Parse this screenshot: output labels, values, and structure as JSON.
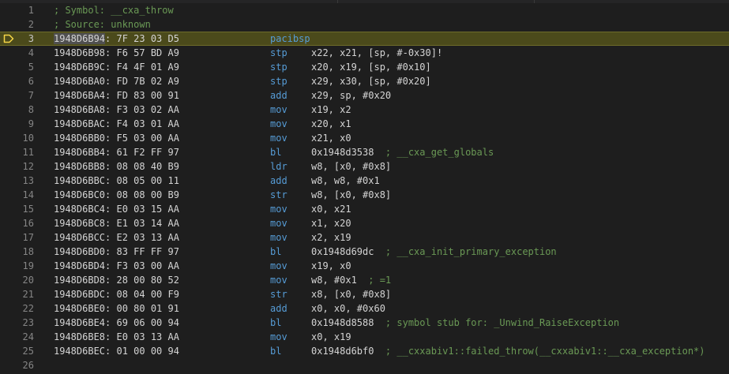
{
  "editor": {
    "lines": [
      {
        "n": "1",
        "comment": "; Symbol: __cxa_throw"
      },
      {
        "n": "2",
        "comment": "; Source: unknown"
      },
      {
        "n": "3",
        "addr": "1948D6B94",
        "bytes": ": 7F 23 03 D5",
        "mnem": "pacibsp",
        "ops": "",
        "cmt": "",
        "current": true
      },
      {
        "n": "4",
        "addr": "1948D6B98",
        "bytes": ": F6 57 BD A9",
        "mnem": "stp",
        "ops": "x22, x21, [sp, #-0x30]!",
        "cmt": ""
      },
      {
        "n": "5",
        "addr": "1948D6B9C",
        "bytes": ": F4 4F 01 A9",
        "mnem": "stp",
        "ops": "x20, x19, [sp, #0x10]",
        "cmt": ""
      },
      {
        "n": "6",
        "addr": "1948D6BA0",
        "bytes": ": FD 7B 02 A9",
        "mnem": "stp",
        "ops": "x29, x30, [sp, #0x20]",
        "cmt": ""
      },
      {
        "n": "7",
        "addr": "1948D6BA4",
        "bytes": ": FD 83 00 91",
        "mnem": "add",
        "ops": "x29, sp, #0x20",
        "cmt": ""
      },
      {
        "n": "8",
        "addr": "1948D6BA8",
        "bytes": ": F3 03 02 AA",
        "mnem": "mov",
        "ops": "x19, x2",
        "cmt": ""
      },
      {
        "n": "9",
        "addr": "1948D6BAC",
        "bytes": ": F4 03 01 AA",
        "mnem": "mov",
        "ops": "x20, x1",
        "cmt": ""
      },
      {
        "n": "10",
        "addr": "1948D6BB0",
        "bytes": ": F5 03 00 AA",
        "mnem": "mov",
        "ops": "x21, x0",
        "cmt": ""
      },
      {
        "n": "11",
        "addr": "1948D6BB4",
        "bytes": ": 61 F2 FF 97",
        "mnem": "bl",
        "ops": "0x1948d3538  ",
        "cmt": "; __cxa_get_globals"
      },
      {
        "n": "12",
        "addr": "1948D6BB8",
        "bytes": ": 08 08 40 B9",
        "mnem": "ldr",
        "ops": "w8, [x0, #0x8]",
        "cmt": ""
      },
      {
        "n": "13",
        "addr": "1948D6BBC",
        "bytes": ": 08 05 00 11",
        "mnem": "add",
        "ops": "w8, w8, #0x1",
        "cmt": ""
      },
      {
        "n": "14",
        "addr": "1948D6BC0",
        "bytes": ": 08 08 00 B9",
        "mnem": "str",
        "ops": "w8, [x0, #0x8]",
        "cmt": ""
      },
      {
        "n": "15",
        "addr": "1948D6BC4",
        "bytes": ": E0 03 15 AA",
        "mnem": "mov",
        "ops": "x0, x21",
        "cmt": ""
      },
      {
        "n": "16",
        "addr": "1948D6BC8",
        "bytes": ": E1 03 14 AA",
        "mnem": "mov",
        "ops": "x1, x20",
        "cmt": ""
      },
      {
        "n": "17",
        "addr": "1948D6BCC",
        "bytes": ": E2 03 13 AA",
        "mnem": "mov",
        "ops": "x2, x19",
        "cmt": ""
      },
      {
        "n": "18",
        "addr": "1948D6BD0",
        "bytes": ": 83 FF FF 97",
        "mnem": "bl",
        "ops": "0x1948d69dc  ",
        "cmt": "; __cxa_init_primary_exception"
      },
      {
        "n": "19",
        "addr": "1948D6BD4",
        "bytes": ": F3 03 00 AA",
        "mnem": "mov",
        "ops": "x19, x0",
        "cmt": ""
      },
      {
        "n": "20",
        "addr": "1948D6BD8",
        "bytes": ": 28 00 80 52",
        "mnem": "mov",
        "ops": "w8, #0x1  ",
        "cmt": "; =1"
      },
      {
        "n": "21",
        "addr": "1948D6BDC",
        "bytes": ": 08 04 00 F9",
        "mnem": "str",
        "ops": "x8, [x0, #0x8]",
        "cmt": ""
      },
      {
        "n": "22",
        "addr": "1948D6BE0",
        "bytes": ": 00 80 01 91",
        "mnem": "add",
        "ops": "x0, x0, #0x60",
        "cmt": ""
      },
      {
        "n": "23",
        "addr": "1948D6BE4",
        "bytes": ": 69 06 00 94",
        "mnem": "bl",
        "ops": "0x1948d8588  ",
        "cmt": "; symbol stub for: _Unwind_RaiseException"
      },
      {
        "n": "24",
        "addr": "1948D6BE8",
        "bytes": ": E0 03 13 AA",
        "mnem": "mov",
        "ops": "x0, x19",
        "cmt": ""
      },
      {
        "n": "25",
        "addr": "1948D6BEC",
        "bytes": ": 01 00 00 94",
        "mnem": "bl",
        "ops": "0x1948d6bf0  ",
        "cmt": "; __cxxabiv1::failed_throw(__cxxabiv1::__cxa_exception*)"
      },
      {
        "n": "26"
      }
    ],
    "colors": {
      "background": "#1e1e1e",
      "current_line": "#4b4a1b",
      "mnemonic": "#569cd6",
      "comment": "#6a9955",
      "line_number": "#858585",
      "marker": "#f5d547"
    },
    "current_line_marker_icon": "debug-current-line-arrow-icon"
  }
}
